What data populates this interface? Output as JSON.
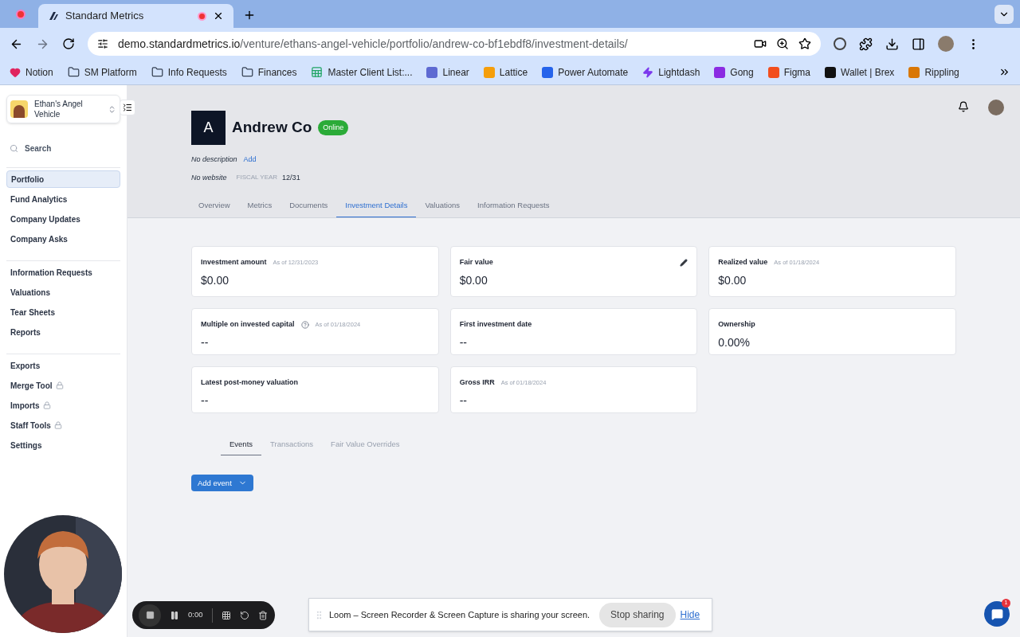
{
  "browser": {
    "tabs": [
      {
        "title": "Standard Metrics",
        "selected": true
      }
    ],
    "url_host": "demo.standardmetrics.io",
    "url_path": "/venture/ethans-angel-vehicle/portfolio/andrew-co-bf1ebdf8/investment-details/",
    "bookmarks": [
      {
        "label": "Notion",
        "kind": "heart"
      },
      {
        "label": "SM Platform",
        "kind": "folder"
      },
      {
        "label": "Info Requests",
        "kind": "folder"
      },
      {
        "label": "Finances",
        "kind": "folder"
      },
      {
        "label": "Master Client List:...",
        "kind": "sheet"
      },
      {
        "label": "Linear",
        "kind": "linear"
      },
      {
        "label": "Lattice",
        "kind": "lattice"
      },
      {
        "label": "Power Automate",
        "kind": "automate"
      },
      {
        "label": "Lightdash",
        "kind": "bolt"
      },
      {
        "label": "Gong",
        "kind": "gong"
      },
      {
        "label": "Figma",
        "kind": "figma"
      },
      {
        "label": "Wallet | Brex",
        "kind": "brex"
      },
      {
        "label": "Rippling",
        "kind": "rippling"
      }
    ]
  },
  "sidebar": {
    "workspace": "Ethan's Angel Vehicle",
    "search": "Search",
    "groups": [
      [
        {
          "label": "Portfolio",
          "selected": true,
          "locked": false
        },
        {
          "label": "Fund Analytics",
          "selected": false,
          "locked": false
        },
        {
          "label": "Company Updates",
          "selected": false,
          "locked": false
        },
        {
          "label": "Company Asks",
          "selected": false,
          "locked": false
        }
      ],
      [
        {
          "label": "Information Requests",
          "selected": false,
          "locked": false
        },
        {
          "label": "Valuations",
          "selected": false,
          "locked": false
        },
        {
          "label": "Tear Sheets",
          "selected": false,
          "locked": false
        },
        {
          "label": "Reports",
          "selected": false,
          "locked": false
        }
      ],
      [
        {
          "label": "Exports",
          "selected": false,
          "locked": false
        },
        {
          "label": "Merge Tool",
          "selected": false,
          "locked": true
        },
        {
          "label": "Imports",
          "selected": false,
          "locked": true
        },
        {
          "label": "Staff Tools",
          "selected": false,
          "locked": true
        },
        {
          "label": "Settings",
          "selected": false,
          "locked": false
        }
      ]
    ]
  },
  "company": {
    "initial": "A",
    "name": "Andrew Co",
    "status": "Online",
    "description": "No description",
    "add_link": "Add",
    "website": "No website",
    "fiscal_year_label": "FISCAL YEAR",
    "fiscal_year": "12/31"
  },
  "tabs": [
    {
      "label": "Overview",
      "selected": false
    },
    {
      "label": "Metrics",
      "selected": false
    },
    {
      "label": "Documents",
      "selected": false
    },
    {
      "label": "Investment Details",
      "selected": true
    },
    {
      "label": "Valuations",
      "selected": false
    },
    {
      "label": "Information Requests",
      "selected": false
    }
  ],
  "cards": [
    {
      "title": "Investment amount",
      "as_of": "As of 12/31/2023",
      "value": "$0.00",
      "help": false,
      "editable": false
    },
    {
      "title": "Fair value",
      "value": "$0.00",
      "help": false,
      "editable": true
    },
    {
      "title": "Realized value",
      "as_of": "As of 01/18/2024",
      "value": "$0.00",
      "help": false,
      "editable": false
    },
    {
      "title": "Multiple on invested capital",
      "as_of": "As of 01/18/2024",
      "value": "--",
      "help": true,
      "editable": false
    },
    {
      "title": "First investment date",
      "value": "--",
      "help": false,
      "editable": false
    },
    {
      "title": "Ownership",
      "value": "0.00%",
      "help": false,
      "editable": false
    },
    {
      "title": "Latest post-money valuation",
      "value": "--",
      "help": false,
      "editable": false
    },
    {
      "title": "Gross IRR",
      "as_of": "As of 01/18/2024",
      "value": "--",
      "help": false,
      "editable": false
    }
  ],
  "sub_tabs": [
    {
      "label": "Events",
      "selected": true
    },
    {
      "label": "Transactions",
      "selected": false
    },
    {
      "label": "Fair Value Overrides",
      "selected": false
    }
  ],
  "add_event_button": "Add event",
  "recorder": {
    "time": "0:00"
  },
  "share_banner": {
    "message": "Loom – Screen Recorder & Screen Capture is sharing your screen.",
    "stop": "Stop sharing",
    "hide": "Hide"
  },
  "chat": {
    "badge": "1"
  }
}
